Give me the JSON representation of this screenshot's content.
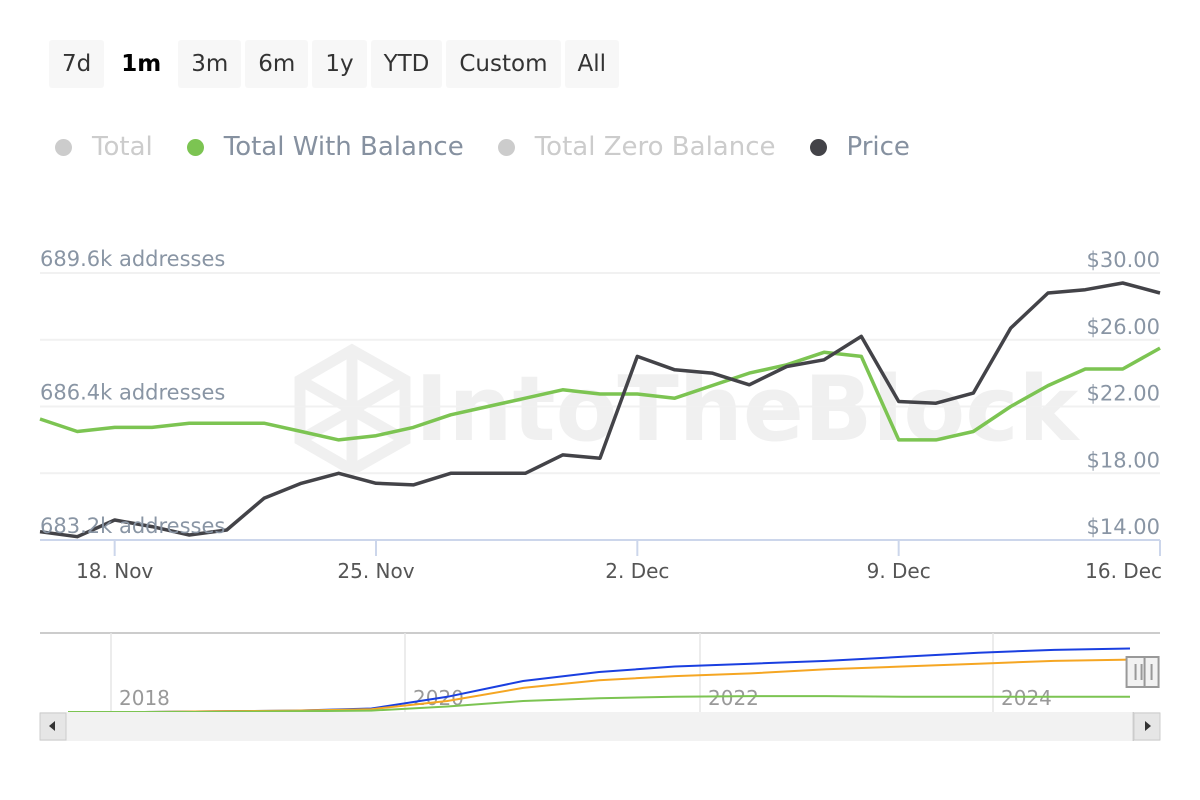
{
  "range_selector": {
    "buttons": [
      "7d",
      "1m",
      "3m",
      "6m",
      "1y",
      "YTD",
      "Custom",
      "All"
    ],
    "active": "1m"
  },
  "legend": [
    {
      "label": "Total",
      "color": "#cccccc",
      "visible": false
    },
    {
      "label": "Total With Balance",
      "color": "#7cc452",
      "visible": true
    },
    {
      "label": "Total Zero Balance",
      "color": "#cccccc",
      "visible": false
    },
    {
      "label": "Price",
      "color": "#434348",
      "visible": true
    }
  ],
  "watermark": "IntoTheBlock",
  "chart_data": {
    "type": "line",
    "title": "",
    "x": [
      "16 Nov",
      "17 Nov",
      "18 Nov",
      "19 Nov",
      "20 Nov",
      "21 Nov",
      "22 Nov",
      "23 Nov",
      "24 Nov",
      "25 Nov",
      "26 Nov",
      "27 Nov",
      "28 Nov",
      "29 Nov",
      "30 Nov",
      "1 Dec",
      "2 Dec",
      "3 Dec",
      "4 Dec",
      "5 Dec",
      "6 Dec",
      "7 Dec",
      "8 Dec",
      "9 Dec",
      "10 Dec",
      "11 Dec",
      "12 Dec",
      "13 Dec",
      "14 Dec",
      "15 Dec",
      "16 Dec"
    ],
    "x_ticks": [
      "18. Nov",
      "25. Nov",
      "2. Dec",
      "9. Dec",
      "16. Dec"
    ],
    "x_tick_dates": [
      "18 Nov",
      "25 Nov",
      "2 Dec",
      "9 Dec",
      "16 Dec"
    ],
    "y_left": {
      "label": "addresses",
      "ticks": [
        "689.6k addresses",
        "686.4k addresses",
        "683.2k addresses"
      ],
      "tick_values": [
        689.6,
        686.4,
        683.2
      ],
      "range": [
        683.2,
        689.6
      ],
      "unit": "k addresses"
    },
    "y_right": {
      "label": "Price",
      "ticks": [
        "$30.00",
        "$26.00",
        "$22.00",
        "$18.00",
        "$14.00"
      ],
      "tick_values": [
        30,
        26,
        22,
        18,
        14
      ],
      "range": [
        14,
        30
      ]
    },
    "grid": true,
    "series": [
      {
        "name": "Total With Balance",
        "axis": "left",
        "color": "#7cc452",
        "values": [
          686.1,
          685.8,
          685.9,
          685.9,
          686.0,
          686.0,
          686.0,
          685.8,
          685.6,
          685.7,
          685.9,
          686.2,
          686.4,
          686.6,
          686.8,
          686.7,
          686.7,
          686.6,
          686.9,
          687.2,
          687.4,
          687.7,
          687.6,
          685.6,
          685.6,
          685.8,
          686.4,
          686.9,
          687.3,
          687.3,
          687.8
        ]
      },
      {
        "name": "Price",
        "axis": "right",
        "color": "#434348",
        "values": [
          14.5,
          14.2,
          15.2,
          14.8,
          14.3,
          14.6,
          16.5,
          17.4,
          18.0,
          17.4,
          17.3,
          18.0,
          18.0,
          18.0,
          19.1,
          18.9,
          25.0,
          24.2,
          24.0,
          23.3,
          24.4,
          24.8,
          26.2,
          22.3,
          22.2,
          22.8,
          26.7,
          28.8,
          29.0,
          29.4,
          28.8
        ]
      }
    ],
    "legend_position": "top-left"
  },
  "navigator": {
    "x_ticks": [
      "2018",
      "2020",
      "2022",
      "2024"
    ],
    "series_colors": [
      "#1a3fe0",
      "#f5a623",
      "#7cc452"
    ],
    "series": [
      {
        "name": "Total",
        "color": "#1a3fe0",
        "values": [
          0.0,
          0.0,
          0.01,
          0.02,
          0.05,
          0.22,
          0.45,
          0.58,
          0.66,
          0.7,
          0.74,
          0.8,
          0.86,
          0.9,
          0.92
        ]
      },
      {
        "name": "Total With Balance",
        "color": "#f5a623",
        "values": [
          0.0,
          0.0,
          0.01,
          0.02,
          0.04,
          0.16,
          0.35,
          0.46,
          0.52,
          0.56,
          0.62,
          0.66,
          0.7,
          0.74,
          0.76
        ]
      },
      {
        "name": "Total Zero Balance",
        "color": "#7cc452",
        "values": [
          0.0,
          0.0,
          0.0,
          0.01,
          0.02,
          0.08,
          0.16,
          0.2,
          0.22,
          0.23,
          0.23,
          0.22,
          0.22,
          0.22,
          0.22
        ]
      }
    ],
    "selected_fraction": [
      0.988,
      1.0
    ]
  }
}
